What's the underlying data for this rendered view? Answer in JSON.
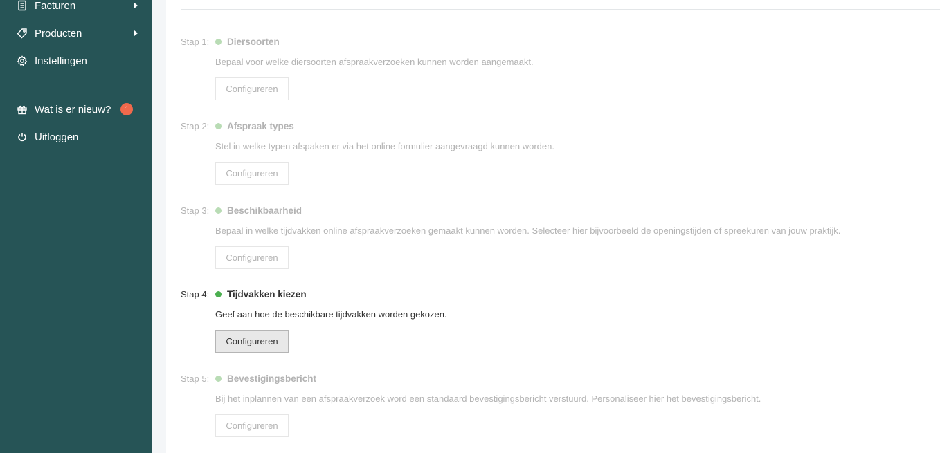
{
  "sidebar": {
    "items": [
      {
        "label": "Facturen",
        "icon": "invoice-icon",
        "has_submenu": true
      },
      {
        "label": "Producten",
        "icon": "tag-icon",
        "has_submenu": true
      },
      {
        "label": "Instellingen",
        "icon": "gear-icon",
        "has_submenu": false
      },
      {
        "label": "Wat is er nieuw?",
        "icon": "gift-icon",
        "badge": "1"
      },
      {
        "label": "Uitloggen",
        "icon": "power-icon"
      }
    ]
  },
  "steps": [
    {
      "num": "Stap 1:",
      "title": "Diersoorten",
      "desc": "Bepaal voor welke diersoorten afspraakverzoeken kunnen worden aangemaakt.",
      "button": "Configureren",
      "active": false
    },
    {
      "num": "Stap 2:",
      "title": "Afspraak types",
      "desc": "Stel in welke typen afspaken er via het online formulier aangevraagd kunnen worden.",
      "button": "Configureren",
      "active": false
    },
    {
      "num": "Stap 3:",
      "title": "Beschikbaarheid",
      "desc": "Bepaal in welke tijdvakken online afspraakverzoeken gemaakt kunnen worden. Selecteer hier bijvoorbeeld de openingstijden of spreekuren van jouw praktijk.",
      "button": "Configureren",
      "active": false
    },
    {
      "num": "Stap 4:",
      "title": "Tijdvakken kiezen",
      "desc": "Geef aan hoe de beschikbare tijdvakken worden gekozen.",
      "button": "Configureren",
      "active": true
    },
    {
      "num": "Stap 5:",
      "title": "Bevestigingsbericht",
      "desc": "Bij het inplannen van een afspraakverzoek word een standaard bevestigingsbericht verstuurd. Personaliseer hier het bevestigingsbericht.",
      "button": "Configureren",
      "active": false
    }
  ],
  "colors": {
    "sidebar_bg": "#265456",
    "badge": "#f0694c",
    "dot_active": "#4caf50",
    "dot_inactive": "#b9dcb5"
  }
}
